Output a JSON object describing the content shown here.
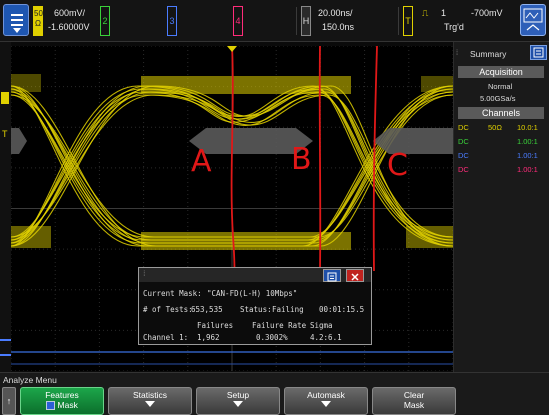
{
  "header": {
    "ch1_label": "50\nΩ",
    "ch1_scale": "600mV/",
    "ch1_offset": "-1.60000V",
    "ch2_label": "2",
    "ch3_label": "3",
    "ch4_label": "4",
    "horiz_label": "H",
    "time_scale": "20.00ns/",
    "time_delay": "150.0ns",
    "trig_label": "T",
    "trig_source": "1",
    "trig_level": "-700mV",
    "trig_status": "Trg'd"
  },
  "right_panel": {
    "summary_label": "Summary",
    "acquisition_title": "Acquisition",
    "acq_mode": "Normal",
    "sample_rate": "5.00GSa/s",
    "channels_title": "Channels",
    "channels": [
      {
        "coupling": "DC",
        "impedance": "50Ω",
        "ratio": "10.0:1",
        "color": "#e0d000"
      },
      {
        "coupling": "DC",
        "impedance": "",
        "ratio": "1.00:1",
        "color": "#3ad13a"
      },
      {
        "coupling": "DC",
        "impedance": "",
        "ratio": "1.00:1",
        "color": "#4a7cff"
      },
      {
        "coupling": "DC",
        "impedance": "",
        "ratio": "1.00:1",
        "color": "#ff2c7a"
      }
    ]
  },
  "annotations": {
    "a": "A",
    "b": "B",
    "c": "C"
  },
  "mask_dialog": {
    "current_mask_label": "Current Mask:",
    "current_mask_value": "\"CAN-FD(L-H) 10Mbps\"",
    "tests_label": "# of Tests:",
    "tests_value": "653,535",
    "status_label": "Status:",
    "status_value": "Failing",
    "elapsed": "00:01:15.5",
    "col_failures": "Failures",
    "col_failure_rate": "Failure Rate",
    "col_sigma": "Sigma",
    "row_label": "Channel 1:",
    "failures": "1,962",
    "failure_rate": "0.3002%",
    "sigma": "4.2:6.1"
  },
  "bottom": {
    "menu_title": "Analyze Menu",
    "softkeys": [
      {
        "label": "Features",
        "sub": "Mask"
      },
      {
        "label": "Statistics",
        "sub": ""
      },
      {
        "label": "Setup",
        "sub": ""
      },
      {
        "label": "Automask",
        "sub": ""
      },
      {
        "label": "Clear",
        "sub": "Mask"
      }
    ]
  },
  "colors": {
    "ch1": "#e0d000",
    "annotation": "#e01818",
    "mask": "#5a5a5a"
  }
}
